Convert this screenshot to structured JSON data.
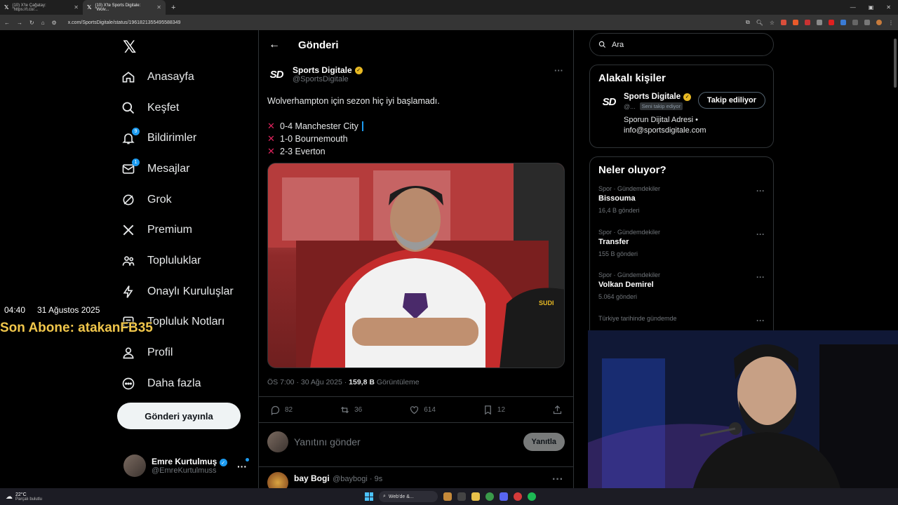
{
  "browser": {
    "tabs": [
      {
        "label": "(10) X'te Çağatay: \"https://t.co/..."
      },
      {
        "label": "(10) X'te Sports Digitale: \"Wolv..."
      }
    ],
    "url": "x.com/SportsDigitale/status/1961821355495588349"
  },
  "nav": {
    "items": [
      {
        "label": "Anasayfa",
        "icon": "home-icon"
      },
      {
        "label": "Keşfet",
        "icon": "search-icon"
      },
      {
        "label": "Bildirimler",
        "icon": "bell-icon",
        "badge": "9"
      },
      {
        "label": "Mesajlar",
        "icon": "mail-icon",
        "badge": "1"
      },
      {
        "label": "Grok",
        "icon": "grok-icon"
      },
      {
        "label": "Premium",
        "icon": "x-icon"
      },
      {
        "label": "Topluluklar",
        "icon": "communities-icon"
      },
      {
        "label": "Onaylı Kuruluşlar",
        "icon": "lightning-icon"
      },
      {
        "label": "Topluluk Notları",
        "icon": "notes-icon"
      },
      {
        "label": "Profil",
        "icon": "person-icon"
      },
      {
        "label": "Daha fazla",
        "icon": "more-circle-icon"
      }
    ],
    "post_button": "Gönderi yayınla",
    "me": {
      "name": "Emre Kurtulmuş",
      "handle": "@EmreKurtulmuss"
    }
  },
  "overlay": {
    "time": "04:40",
    "date": "31 Ağustos 2025",
    "subscriber": "Son Abone: atakanFB35"
  },
  "post": {
    "header": "Gönderi",
    "author": {
      "name": "Sports Digitale",
      "handle": "@SportsDigitale",
      "logo": "SD"
    },
    "text": "Wolverhampton için sezon hiç iyi başlamadı.",
    "results": [
      "0-4 Manchester City",
      "1-0 Bournemouth",
      "2-3 Everton"
    ],
    "meta_time": "ÖS 7:00 · 30 Ağu 2025 · ",
    "views_count": "159,8 B",
    "views_label": " Görüntüleme",
    "actions": {
      "replies": "82",
      "reposts": "36",
      "likes": "614",
      "bookmarks": "12"
    },
    "reply_placeholder": "Yanıtını gönder",
    "reply_button": "Yanıtla",
    "next": {
      "name": "bay Bogi",
      "handle": "@baybogi · 9s"
    }
  },
  "right": {
    "search_placeholder": "Ara",
    "relevant_title": "Alakalı kişiler",
    "relevant": {
      "name": "Sports Digitale",
      "handle": "@...",
      "follows_you": "Seni takip ediyor",
      "follow_button": "Takip ediliyor",
      "bio_line1": "Sporun Dijital Adresi •",
      "bio_line2": "info@sportsdigitale.com"
    },
    "trends_title": "Neler oluyor?",
    "trends": [
      {
        "context": "Spor · Gündemdekiler",
        "name": "Bissouma",
        "count": "16,4 B gönderi"
      },
      {
        "context": "Spor · Gündemdekiler",
        "name": "Transfer",
        "count": "155 B gönderi"
      },
      {
        "context": "Spor · Gündemdekiler",
        "name": "Volkan Demirel",
        "count": "5.064 gönderi"
      },
      {
        "context": "Türkiye tarihinde gündemde",
        "name": "",
        "count": ""
      }
    ]
  },
  "taskbar": {
    "temp": "22°C",
    "weather": "Parçalı bulutlu",
    "search": "Web'de &..."
  }
}
